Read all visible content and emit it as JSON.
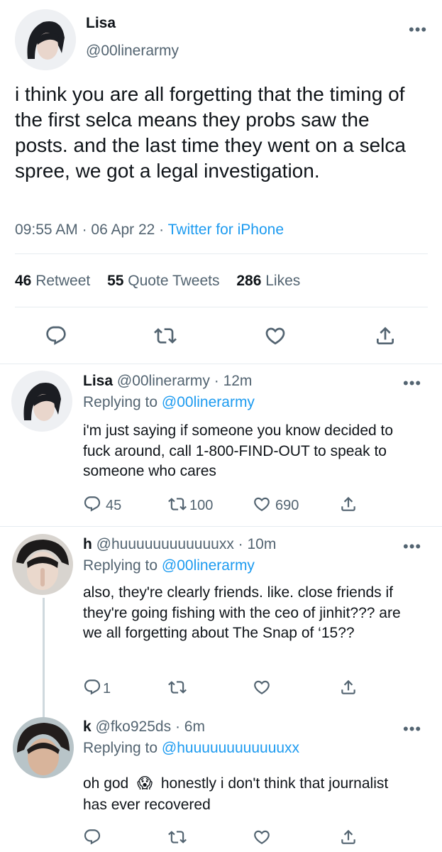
{
  "main_tweet": {
    "name": "Lisa",
    "handle": "@00linerarmy",
    "text": "i think you are all forgetting that the timing of the first selca means they probs saw the posts. and the last time they went on a selca spree, we got a legal investigation.",
    "time": "09:55 AM",
    "date": "06 Apr 22",
    "source": "Twitter for iPhone",
    "retweets": "46",
    "retweets_label": "Retweet",
    "quotes": "55",
    "quotes_label": "Quote Tweets",
    "likes": "286",
    "likes_label": "Likes"
  },
  "replies": [
    {
      "name": "Lisa",
      "handle": "@00linerarmy",
      "age": "12m",
      "replying_label": "Replying to",
      "replying_to": "@00linerarmy",
      "text": "i'm just saying if someone you know decided to fuck around, call 1-800-FIND-OUT to speak to someone who cares",
      "reply_count": "45",
      "retweet_count": "100",
      "like_count": "690"
    },
    {
      "name": "h",
      "handle": "@huuuuuuuuuuuuxx",
      "age": "10m",
      "replying_label": "Replying to",
      "replying_to": "@00linerarmy",
      "text": "also, they're clearly friends. like. close friends if they're going fishing with the ceo of jinhit??? are we all forgetting about The Snap of ‘15??",
      "reply_count": "1",
      "retweet_count": "",
      "like_count": ""
    },
    {
      "name": "k",
      "handle": "@fko925ds",
      "age": "6m",
      "replying_label": "Replying to",
      "replying_to": "@huuuuuuuuuuuuxx",
      "text_before": "oh god",
      "emoji": "😱",
      "text_after": "honestly i don't think that journalist has ever recovered",
      "reply_count": "",
      "retweet_count": "",
      "like_count": ""
    }
  ],
  "icons": {
    "more": "more-icon",
    "reply": "reply-icon",
    "retweet": "retweet-icon",
    "like": "like-icon",
    "share": "share-icon"
  },
  "colors": {
    "link": "#1d9bf0",
    "muted": "#536471",
    "divider": "#e6ecf0"
  }
}
